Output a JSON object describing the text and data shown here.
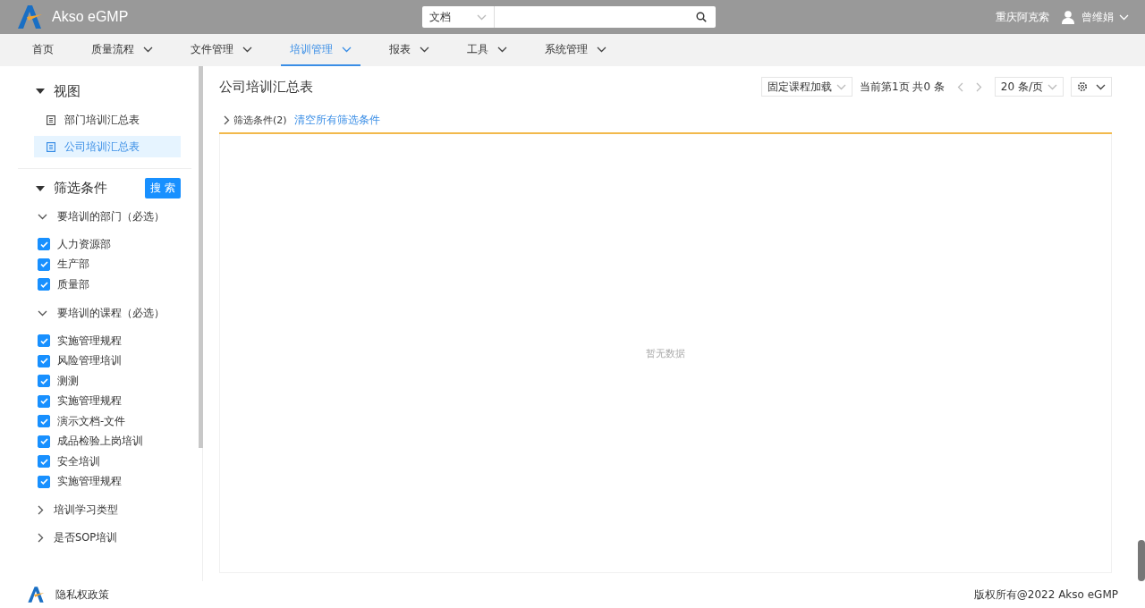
{
  "header": {
    "logo_text": "Akso eGMP",
    "search": {
      "scope": "文档"
    },
    "company": "重庆阿克索",
    "user": "曾维娟"
  },
  "nav": [
    {
      "label": "首页",
      "has_menu": false,
      "selected": false
    },
    {
      "label": "质量流程",
      "has_menu": true,
      "selected": false
    },
    {
      "label": "文件管理",
      "has_menu": true,
      "selected": false
    },
    {
      "label": "培训管理",
      "has_menu": true,
      "selected": true
    },
    {
      "label": "报表",
      "has_menu": true,
      "selected": false
    },
    {
      "label": "工具",
      "has_menu": true,
      "selected": false
    },
    {
      "label": "系统管理",
      "has_menu": true,
      "selected": false
    }
  ],
  "sidebar": {
    "views": {
      "title": "视图",
      "expanded": true,
      "items": [
        {
          "label": "部门培训汇总表",
          "selected": false
        },
        {
          "label": "公司培训汇总表",
          "selected": true
        }
      ]
    },
    "filters": {
      "title": "筛选条件",
      "expanded": true,
      "search_button": "搜 索",
      "groups": [
        {
          "label": "要培训的部门（必选）",
          "expanded": true,
          "options": [
            {
              "label": "人力资源部",
              "checked": true
            },
            {
              "label": "生产部",
              "checked": true
            },
            {
              "label": "质量部",
              "checked": true
            }
          ]
        },
        {
          "label": "要培训的课程（必选）",
          "expanded": true,
          "options": [
            {
              "label": "实施管理规程",
              "checked": true
            },
            {
              "label": "风险管理培训",
              "checked": true
            },
            {
              "label": "测测",
              "checked": true
            },
            {
              "label": "实施管理规程",
              "checked": true
            },
            {
              "label": "演示文档-文件",
              "checked": true
            },
            {
              "label": "成品检验上岗培训",
              "checked": true
            },
            {
              "label": "安全培训",
              "checked": true
            },
            {
              "label": "实施管理规程",
              "checked": true
            }
          ]
        },
        {
          "label": "培训学习类型",
          "expanded": false
        },
        {
          "label": "是否SOP培训",
          "expanded": false
        }
      ]
    }
  },
  "main": {
    "title": "公司培训汇总表",
    "load_button": "固定课程加载",
    "page_info": "当前第1页 共0 条",
    "page_size": "20 条/页",
    "filter_bar": {
      "label": "筛选条件(2)",
      "expanded": false,
      "clear_link": "清空所有筛选条件"
    },
    "empty_text": "暂无数据"
  },
  "footer": {
    "privacy": "隐私权政策",
    "copyright": "版权所有@2022 Akso eGMP"
  }
}
